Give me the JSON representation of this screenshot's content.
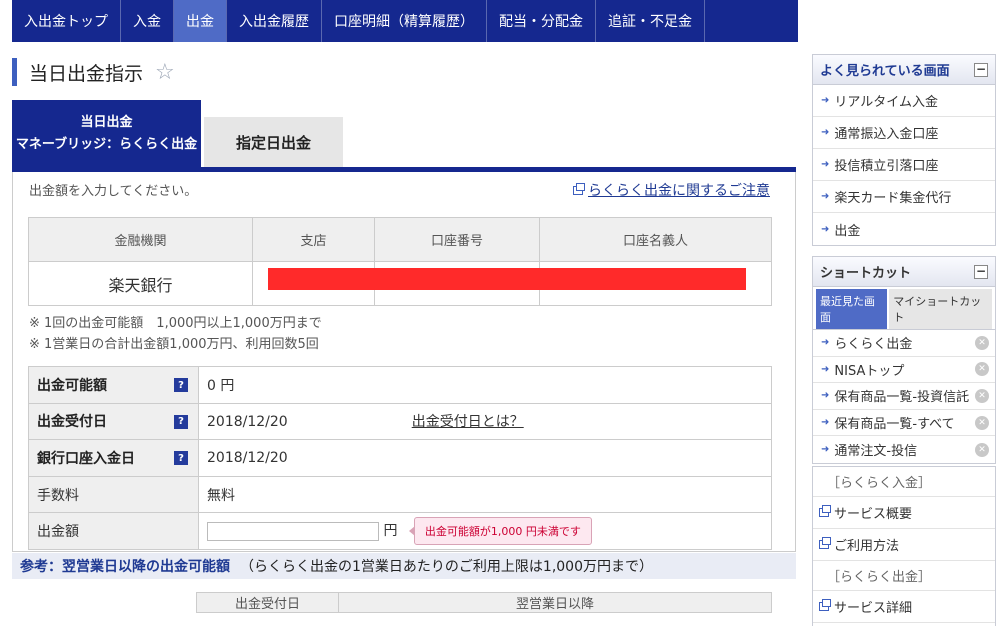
{
  "nav": [
    "入出金トップ",
    "入金",
    "出金",
    "入出金履歴",
    "口座明細（精算履歴）",
    "配当・分配金",
    "追証・不足金"
  ],
  "page_title": "当日出金指示",
  "tabs": {
    "active_line1": "当日出金",
    "active_line2": "マネーブリッジ：らくらく出金",
    "inactive": "指定日出金"
  },
  "intro": "出金額を入力してください。",
  "notice_link": "らくらく出金に関するご注意",
  "bank_table": {
    "headers": [
      "金融機関",
      "支店",
      "口座番号",
      "口座名義人"
    ],
    "row": [
      "楽天銀行",
      "",
      "",
      ""
    ]
  },
  "notes": [
    "※ 1回の出金可能額　1,000円以上1,000万円まで",
    "※ 1営業日の合計出金額1,000万円、利用回数5回"
  ],
  "form": {
    "available_label": "出金可能額",
    "available_value": "0 円",
    "accept_label": "出金受付日",
    "accept_value": "2018/12/20",
    "accept_link": "出金受付日とは？",
    "deposit_label": "銀行口座入金日",
    "deposit_value": "2018/12/20",
    "fee_label": "手数料",
    "fee_value": "無料",
    "amount_label": "出金額",
    "amount_value": "",
    "amount_unit": "円",
    "warning": "出金可能額が1,000 円未満です",
    "help_glyph": "?"
  },
  "reference": {
    "title": "参考：翌営業日以降の出金可能額",
    "note": "（らくらく出金の1営業日あたりのご利用上限は1,000万円まで）"
  },
  "bottom_table_headers": [
    "出金受付日",
    "翌営業日以降"
  ],
  "sidebar": {
    "frequent_title": "よく見られている画面",
    "frequent": [
      "リアルタイム入金",
      "通常振込入金口座",
      "投信積立引落口座",
      "楽天カード集金代行",
      "出金"
    ],
    "shortcut_title": "ショートカット",
    "shortcut_tabs": [
      "最近見た画面",
      "マイショートカット"
    ],
    "recent": [
      "らくらく出金",
      "NISAトップ",
      "保有商品一覧-投資信託",
      "保有商品一覧-すべて",
      "通常注文-投信"
    ],
    "section1": "［らくらく入金］",
    "section1_items": [
      "サービス概要",
      "ご利用方法"
    ],
    "section2": "［らくらく出金］",
    "section2_items": [
      "サービス詳細"
    ]
  }
}
